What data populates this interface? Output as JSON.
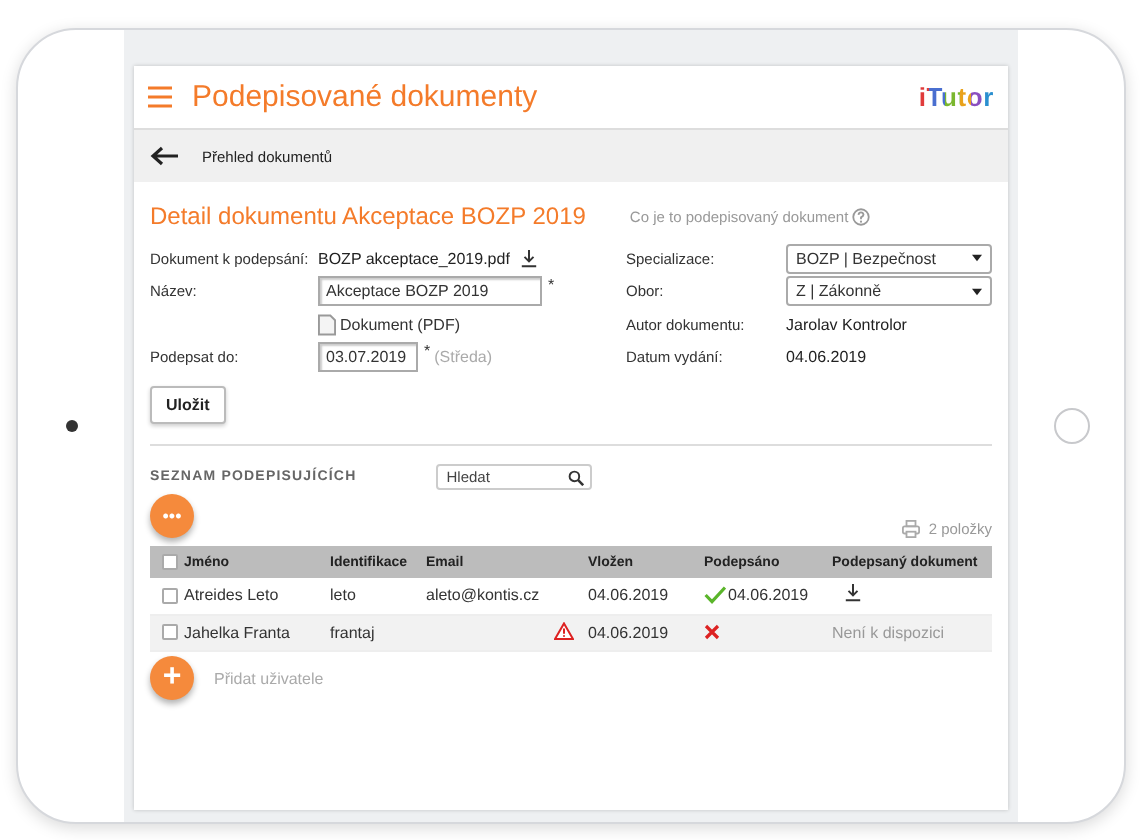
{
  "header": {
    "title": "Podepisované dokumenty",
    "logo": "iTutor"
  },
  "nav": {
    "label": "Přehled dokumentů"
  },
  "detail": {
    "title": "Detail dokumentu Akceptace BOZP 2019",
    "help": "Co je to podepisovaný dokument"
  },
  "form_left": [
    {
      "kind": "file",
      "label": "Dokument k podepsání:",
      "value": "BOZP akceptace_2019.pdf"
    },
    {
      "kind": "input",
      "label": "Název:",
      "value": "Akceptace BOZP 2019",
      "required": "*"
    },
    {
      "kind": "attachment",
      "value": "Dokument (PDF)"
    },
    {
      "kind": "date",
      "label": "Podepsat do:",
      "value": "03.07.2019",
      "required": "*",
      "note": "(Středa)"
    }
  ],
  "form_right": [
    {
      "kind": "select",
      "label": "Specializace:",
      "value": "BOZP | Bezpečnost"
    },
    {
      "kind": "select",
      "label": "Obor:",
      "value": "Z | Zákonně"
    },
    {
      "kind": "text",
      "label": "Autor dokumentu:",
      "value": "Jarolav Kontrolor"
    },
    {
      "kind": "text",
      "label": "Datum vydání:",
      "value": "04.06.2019"
    }
  ],
  "save_button": "Uložit",
  "more_button": "•••",
  "add_button": "+",
  "signers": {
    "heading": "SEZNAM PODEPISUJÍCÍCH",
    "search": {
      "placeholder": "Hledat"
    },
    "count": "2 položky",
    "columns": [
      "Jméno",
      "Identifikace",
      "Email",
      "Vložen",
      "Podepsáno",
      "Podepsaný dokument"
    ],
    "header_checked": false,
    "rows": [
      {
        "checked": false,
        "name": "Atreides Leto",
        "id": "leto",
        "email": "aleto@kontis.cz",
        "warning": false,
        "inserted": "04.06.2019",
        "signed": true,
        "signed_date": "04.06.2019",
        "document": {
          "kind": "download"
        }
      },
      {
        "checked": false,
        "name": "Jahelka Franta",
        "id": "frantaj",
        "warning": true,
        "inserted": "04.06.2019",
        "signed": false,
        "document": {
          "kind": "text",
          "text": "Není k dispozici"
        }
      }
    ],
    "add_label": "Přidat uživatele"
  }
}
